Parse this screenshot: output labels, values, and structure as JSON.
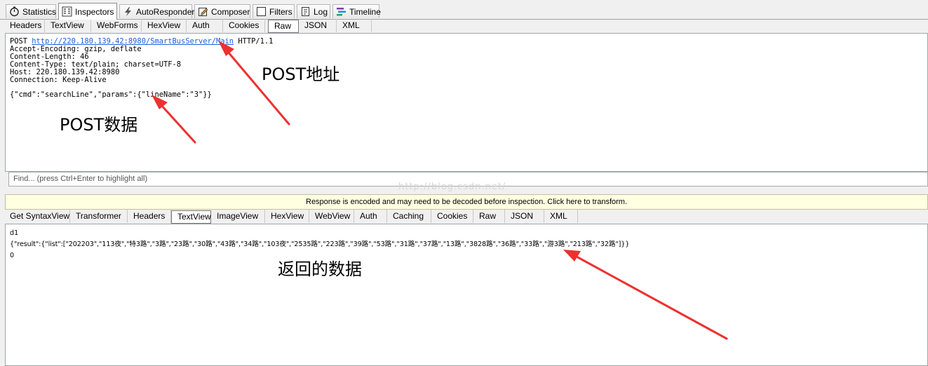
{
  "main_tabs": [
    {
      "label": "Statistics",
      "icon": "stopwatch-icon"
    },
    {
      "label": "Inspectors",
      "icon": "inspectors-icon"
    },
    {
      "label": "AutoResponder",
      "icon": "lightning-icon"
    },
    {
      "label": "Composer",
      "icon": "composer-icon"
    },
    {
      "label": "Filters",
      "icon": "checkbox-icon"
    },
    {
      "label": "Log",
      "icon": "log-icon"
    },
    {
      "label": "Timeline",
      "icon": "timeline-icon"
    }
  ],
  "request_tabs": [
    "Headers",
    "TextView",
    "WebForms",
    "HexView",
    "Auth",
    "Cookies",
    "Raw",
    "JSON",
    "XML"
  ],
  "request": {
    "method": "POST",
    "url": "http://220.180.139.42:8980/SmartBusServer/Main",
    "version": "HTTP/1.1",
    "headers": [
      "Accept-Encoding: gzip, deflate",
      "Content-Length: 46",
      "Content-Type: text/plain; charset=UTF-8",
      "Host: 220.180.139.42:8980",
      "Connection: Keep-Alive"
    ],
    "body": "{\"cmd\":\"searchLine\",\"params\":{\"lineName\":\"3\"}}"
  },
  "find_placeholder": "Find... (press Ctrl+Enter to highlight all)",
  "watermark": "http://blog.csdn.net/",
  "banner": "Response is encoded and may need to be decoded before inspection. Click here to transform.",
  "response_tabs": [
    "Get SyntaxView",
    "Transformer",
    "Headers",
    "TextView",
    "ImageView",
    "HexView",
    "WebView",
    "Auth",
    "Caching",
    "Cookies",
    "Raw",
    "JSON",
    "XML"
  ],
  "response": {
    "lines": [
      "d1",
      "{\"result\":{\"list\":[\"202203\",\"113夜\",\"特3路\",\"3路\",\"23路\",\"30路\",\"43路\",\"34路\",\"103夜\",\"2535路\",\"223路\",\"39路\",\"53路\",\"31路\",\"37路\",\"13路\",\"3828路\",\"36路\",\"33路\",\"游3路\",\"213路\",\"32路\"]}}",
      "0"
    ]
  },
  "annotations": {
    "post_url": "POST地址",
    "post_data": "POST数据",
    "returned_data": "返回的数据",
    "arrow_color": "#ee3030"
  }
}
